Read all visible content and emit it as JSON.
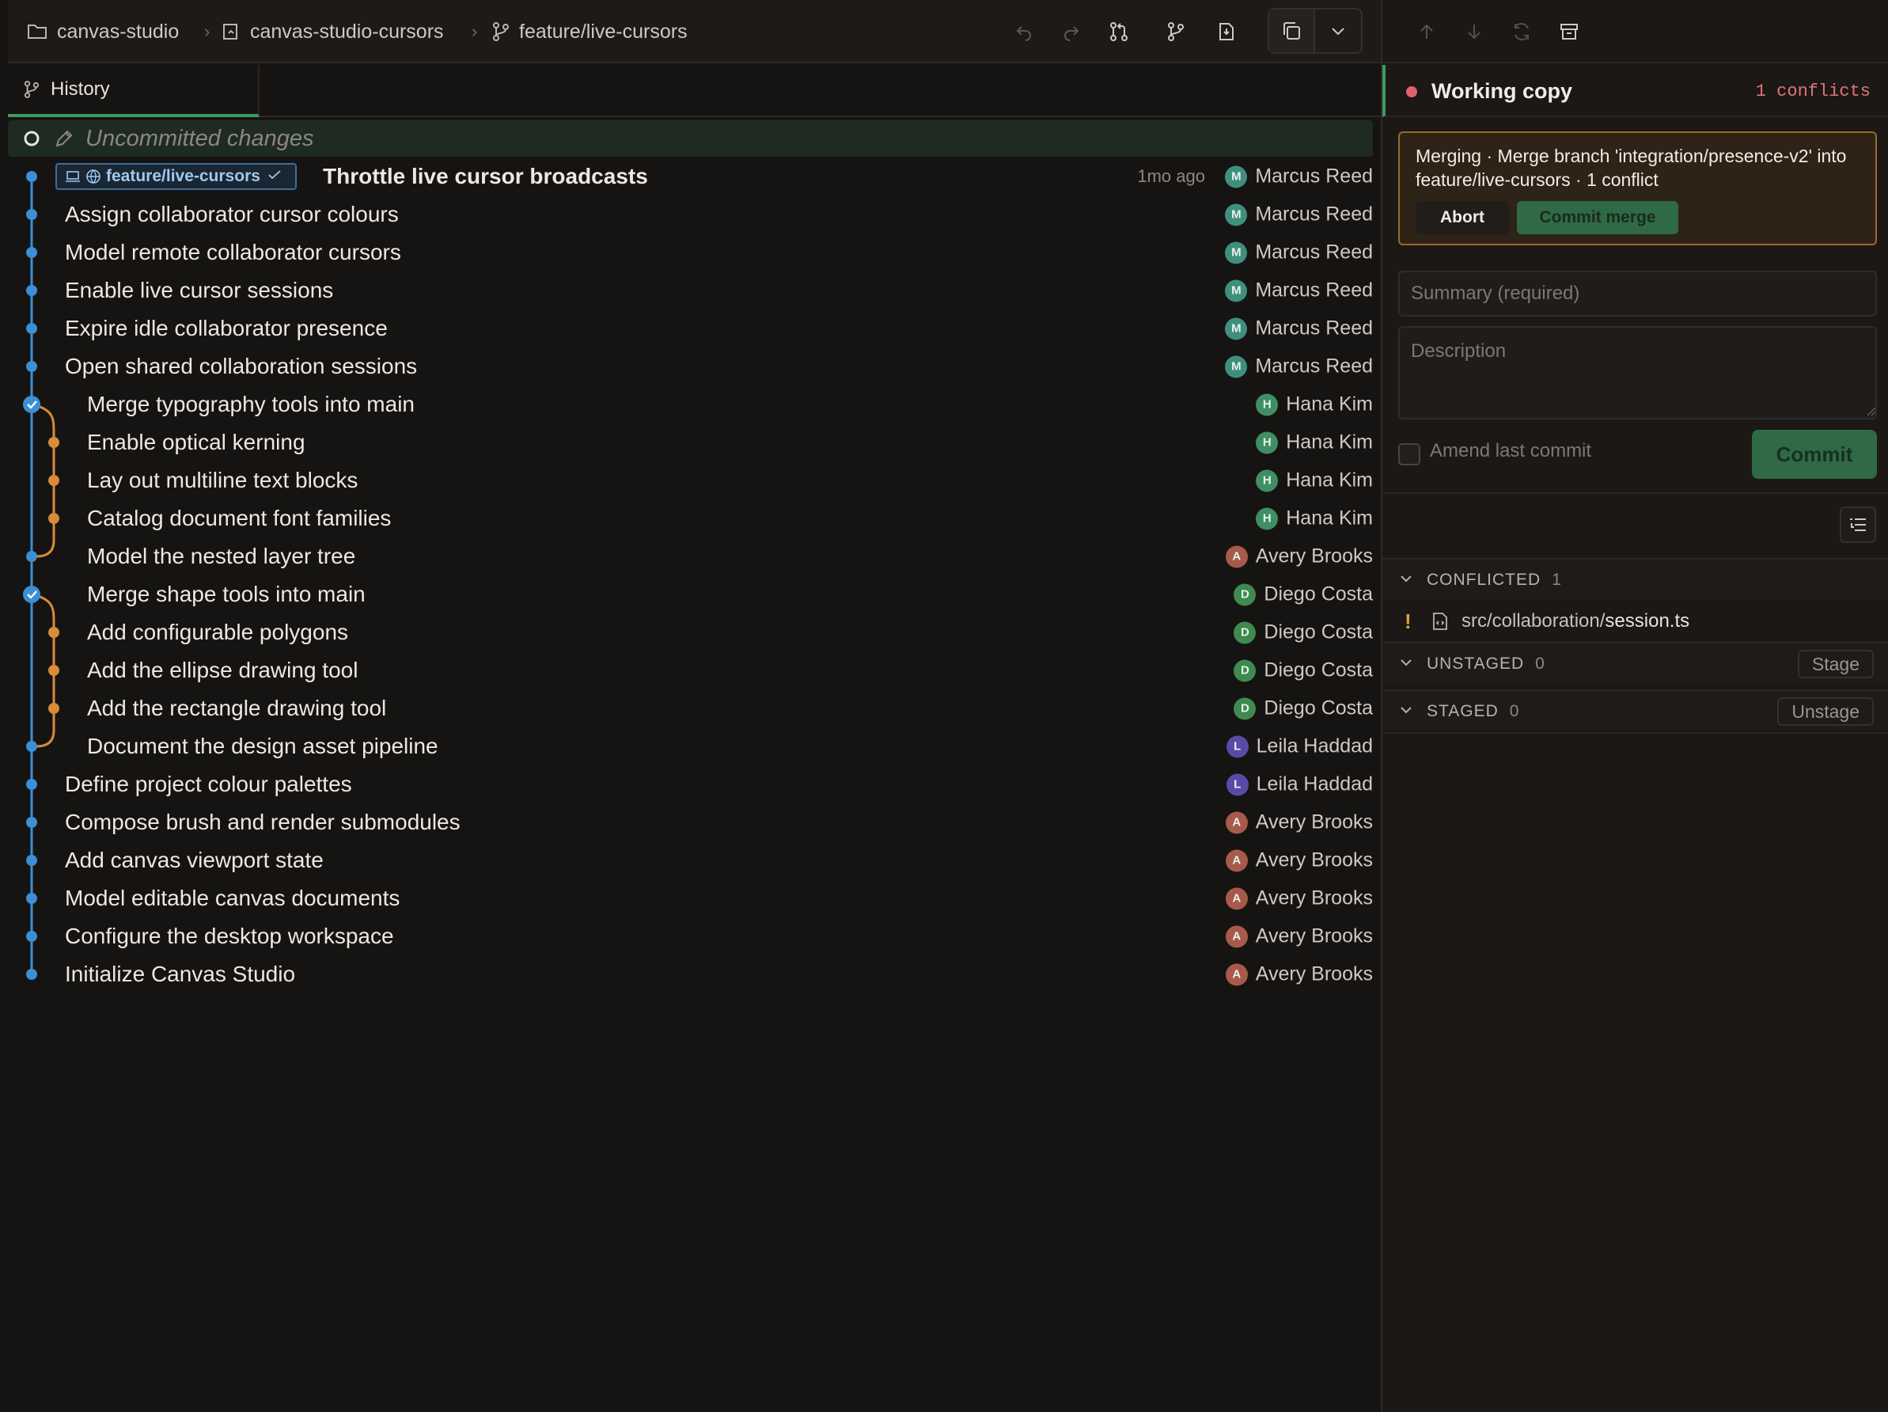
{
  "breadcrumb": {
    "repo_group": "canvas-studio",
    "repo": "canvas-studio-cursors",
    "branch": "feature/live-cursors"
  },
  "tab": {
    "label": "History"
  },
  "uncommitted": {
    "label": "Uncommitted changes"
  },
  "head_chip": {
    "label": "feature/live-cursors"
  },
  "commits": [
    {
      "title": "Throttle live cursor broadcasts",
      "age": "1mo ago",
      "author": "Marcus Reed",
      "initial": "M",
      "avatar_color": "#3f8f7f"
    },
    {
      "title": "Assign collaborator cursor colours",
      "author": "Marcus Reed",
      "initial": "M",
      "avatar_color": "#3f8f7f"
    },
    {
      "title": "Model remote collaborator cursors",
      "author": "Marcus Reed",
      "initial": "M",
      "avatar_color": "#3f8f7f"
    },
    {
      "title": "Enable live cursor sessions",
      "author": "Marcus Reed",
      "initial": "M",
      "avatar_color": "#3f8f7f"
    },
    {
      "title": "Expire idle collaborator presence",
      "author": "Marcus Reed",
      "initial": "M",
      "avatar_color": "#3f8f7f"
    },
    {
      "title": "Open shared collaboration sessions",
      "author": "Marcus Reed",
      "initial": "M",
      "avatar_color": "#3f8f7f"
    },
    {
      "title": "Merge typography tools into main",
      "author": "Hana Kim",
      "initial": "H",
      "avatar_color": "#3f8f65"
    },
    {
      "title": "Enable optical kerning",
      "author": "Hana Kim",
      "initial": "H",
      "avatar_color": "#3f8f65"
    },
    {
      "title": "Lay out multiline text blocks",
      "author": "Hana Kim",
      "initial": "H",
      "avatar_color": "#3f8f65"
    },
    {
      "title": "Catalog document font families",
      "author": "Hana Kim",
      "initial": "H",
      "avatar_color": "#3f8f65"
    },
    {
      "title": "Model the nested layer tree",
      "author": "Avery Brooks",
      "initial": "A",
      "avatar_color": "#a85a4a"
    },
    {
      "title": "Merge shape tools into main",
      "author": "Diego Costa",
      "initial": "D",
      "avatar_color": "#3f8a4f"
    },
    {
      "title": "Add configurable polygons",
      "author": "Diego Costa",
      "initial": "D",
      "avatar_color": "#3f8a4f"
    },
    {
      "title": "Add the ellipse drawing tool",
      "author": "Diego Costa",
      "initial": "D",
      "avatar_color": "#3f8a4f"
    },
    {
      "title": "Add the rectangle drawing tool",
      "author": "Diego Costa",
      "initial": "D",
      "avatar_color": "#3f8a4f"
    },
    {
      "title": "Document the design asset pipeline",
      "author": "Leila Haddad",
      "initial": "L",
      "avatar_color": "#5a4aa8"
    },
    {
      "title": "Define project colour palettes",
      "author": "Leila Haddad",
      "initial": "L",
      "avatar_color": "#5a4aa8"
    },
    {
      "title": "Compose brush and render submodules",
      "author": "Avery Brooks",
      "initial": "A",
      "avatar_color": "#a85a4a"
    },
    {
      "title": "Add canvas viewport state",
      "author": "Avery Brooks",
      "initial": "A",
      "avatar_color": "#a85a4a"
    },
    {
      "title": "Model editable canvas documents",
      "author": "Avery Brooks",
      "initial": "A",
      "avatar_color": "#a85a4a"
    },
    {
      "title": "Configure the desktop workspace",
      "author": "Avery Brooks",
      "initial": "A",
      "avatar_color": "#a85a4a"
    },
    {
      "title": "Initialize Canvas Studio",
      "author": "Avery Brooks",
      "initial": "A",
      "avatar_color": "#a85a4a"
    }
  ],
  "working_copy": {
    "label": "Working copy",
    "conflicts_label": "1 conflicts",
    "merge_message": "Merging · Merge branch 'integration/presence-v2' into feature/live-cursors · 1 conflict",
    "abort_label": "Abort",
    "commit_merge_label": "Commit merge",
    "summary_placeholder": "Summary (required)",
    "description_placeholder": "Description",
    "amend_label": "Amend last commit",
    "commit_label": "Commit"
  },
  "sections": {
    "conflicted": {
      "label": "CONFLICTED",
      "count": "1"
    },
    "unstaged": {
      "label": "UNSTAGED",
      "count": "0",
      "action": "Stage"
    },
    "staged": {
      "label": "STAGED",
      "count": "0",
      "action": "Unstage"
    }
  },
  "conflicted_file": {
    "marker": "!",
    "dir": "src/collaboration/",
    "name": "session.ts"
  },
  "colors": {
    "graph_main": "#3a8fd6",
    "graph_branch": "#d98a3a",
    "accent_green": "#3f9b5d",
    "conflict_red": "#e0616b"
  }
}
